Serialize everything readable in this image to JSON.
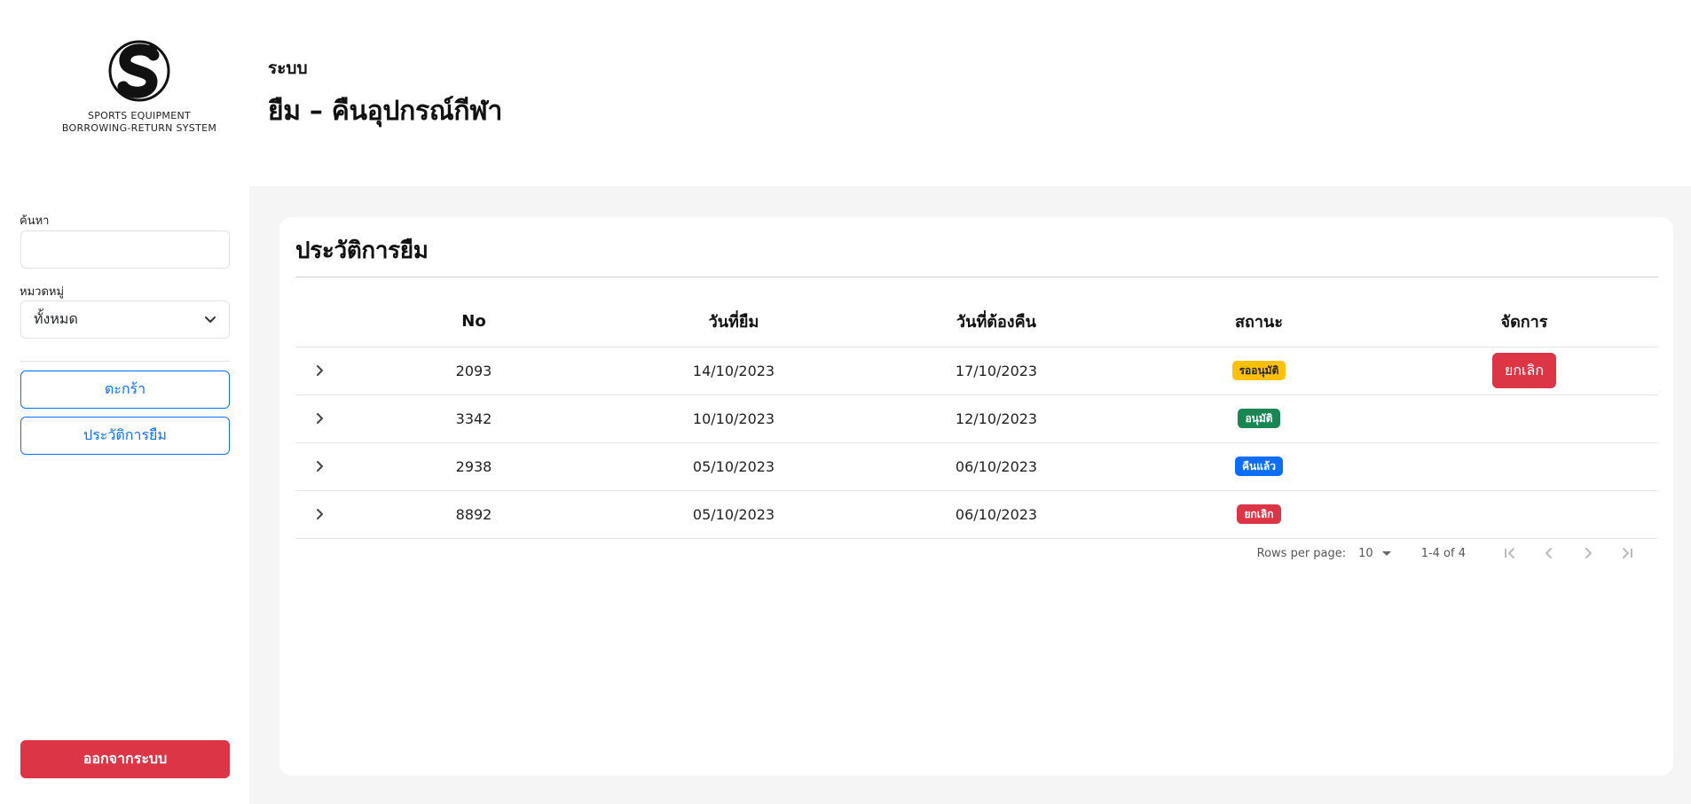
{
  "header": {
    "logo_caption_line1": "SPORTS EQUIPMENT",
    "logo_caption_line2": "BORROWING-RETURN SYSTEM",
    "system_label": "ระบบ",
    "system_title": "ยืม – คืนอุปกรณ์กีฬา"
  },
  "sidebar": {
    "search_label": "ค้นหา",
    "search_value": "",
    "category_label": "หมวดหมู่",
    "category_selected": "ทั้งหมด",
    "cart_button": "ตะกร้า",
    "history_button": "ประวัติการยืม",
    "logout_button": "ออกจากระบบ"
  },
  "main": {
    "title": "ประวัติการยืม",
    "columns": {
      "no": "No",
      "borrow_date": "วันที่ยืม",
      "due_date": "วันที่ต้องคืน",
      "status": "สถานะ",
      "manage": "จัดการ"
    },
    "rows": [
      {
        "no": "2093",
        "borrow_date": "14/10/2023",
        "due_date": "17/10/2023",
        "status": "รออนุมัติ",
        "action": "ยกเลิก"
      },
      {
        "no": "3342",
        "borrow_date": "10/10/2023",
        "due_date": "12/10/2023",
        "status": "อนุมัติ",
        "action": ""
      },
      {
        "no": "2938",
        "borrow_date": "05/10/2023",
        "due_date": "06/10/2023",
        "status": "คืนแล้ว",
        "action": ""
      },
      {
        "no": "8892",
        "borrow_date": "05/10/2023",
        "due_date": "06/10/2023",
        "status": "ยกเลิก",
        "action": ""
      }
    ],
    "pagination": {
      "rows_per_page_label": "Rows per page:",
      "rows_per_page_value": "10",
      "range": "1-4 of 4"
    }
  },
  "colors": {
    "primary": "#0d6efd",
    "danger": "#dc3545",
    "warning": "#ffc107",
    "success": "#198754",
    "page_background": "#f5f5f5"
  },
  "icons": {
    "logo": "s-brush-logo",
    "select_caret": "chevron-down-icon",
    "row_expand": "chevron-right-icon",
    "first_page": "first-page-icon",
    "prev_page": "chevron-left-icon",
    "next_page": "chevron-right-icon",
    "last_page": "last-page-icon"
  }
}
